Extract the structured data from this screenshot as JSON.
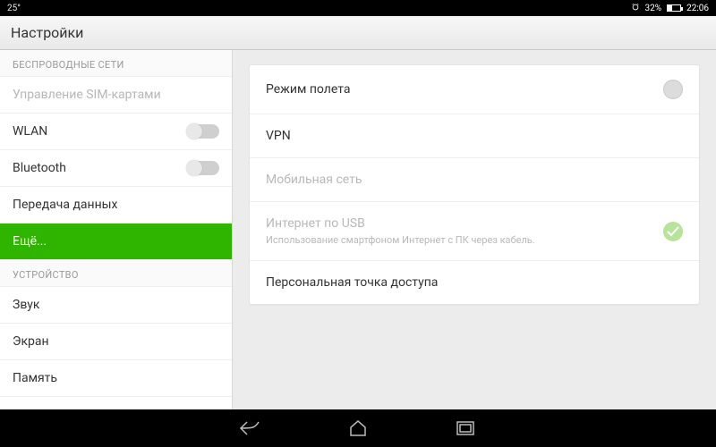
{
  "statusbar": {
    "temp": "25°",
    "battery_pct": "32%",
    "time": "22:06",
    "alarm": true
  },
  "header": {
    "title": "Настройки"
  },
  "sidebar": {
    "section_wireless": "БЕСПРОВОДНЫЕ СЕТИ",
    "section_device": "УСТРОЙСТВО",
    "items": {
      "sim": "Управление SIM-картами",
      "wlan": "WLAN",
      "bluetooth": "Bluetooth",
      "data": "Передача данных",
      "more": "Ещё...",
      "sound": "Звук",
      "display": "Экран",
      "storage": "Память"
    }
  },
  "content": {
    "airplane": "Режим полета",
    "vpn": "VPN",
    "mobile_net": "Мобильная сеть",
    "usb_internet": {
      "title": "Интернет по USB",
      "subtitle": "Использование смартфоном Интернет с ПК через кабель."
    },
    "hotspot": "Персональная точка доступа"
  }
}
